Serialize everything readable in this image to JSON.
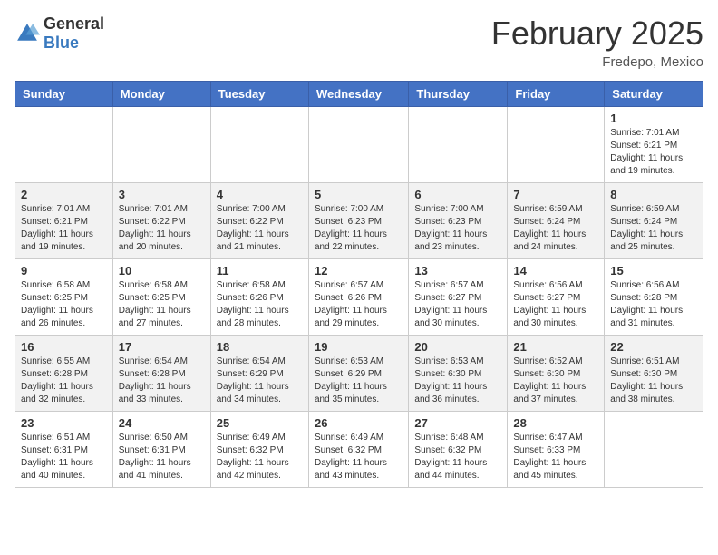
{
  "header": {
    "logo_general": "General",
    "logo_blue": "Blue",
    "month_title": "February 2025",
    "location": "Fredepo, Mexico"
  },
  "weekdays": [
    "Sunday",
    "Monday",
    "Tuesday",
    "Wednesday",
    "Thursday",
    "Friday",
    "Saturday"
  ],
  "weeks": [
    [
      {
        "day": "",
        "info": ""
      },
      {
        "day": "",
        "info": ""
      },
      {
        "day": "",
        "info": ""
      },
      {
        "day": "",
        "info": ""
      },
      {
        "day": "",
        "info": ""
      },
      {
        "day": "",
        "info": ""
      },
      {
        "day": "1",
        "info": "Sunrise: 7:01 AM\nSunset: 6:21 PM\nDaylight: 11 hours and 19 minutes."
      }
    ],
    [
      {
        "day": "2",
        "info": "Sunrise: 7:01 AM\nSunset: 6:21 PM\nDaylight: 11 hours and 19 minutes."
      },
      {
        "day": "3",
        "info": "Sunrise: 7:01 AM\nSunset: 6:22 PM\nDaylight: 11 hours and 20 minutes."
      },
      {
        "day": "4",
        "info": "Sunrise: 7:00 AM\nSunset: 6:22 PM\nDaylight: 11 hours and 21 minutes."
      },
      {
        "day": "5",
        "info": "Sunrise: 7:00 AM\nSunset: 6:23 PM\nDaylight: 11 hours and 22 minutes."
      },
      {
        "day": "6",
        "info": "Sunrise: 7:00 AM\nSunset: 6:23 PM\nDaylight: 11 hours and 23 minutes."
      },
      {
        "day": "7",
        "info": "Sunrise: 6:59 AM\nSunset: 6:24 PM\nDaylight: 11 hours and 24 minutes."
      },
      {
        "day": "8",
        "info": "Sunrise: 6:59 AM\nSunset: 6:24 PM\nDaylight: 11 hours and 25 minutes."
      }
    ],
    [
      {
        "day": "9",
        "info": "Sunrise: 6:58 AM\nSunset: 6:25 PM\nDaylight: 11 hours and 26 minutes."
      },
      {
        "day": "10",
        "info": "Sunrise: 6:58 AM\nSunset: 6:25 PM\nDaylight: 11 hours and 27 minutes."
      },
      {
        "day": "11",
        "info": "Sunrise: 6:58 AM\nSunset: 6:26 PM\nDaylight: 11 hours and 28 minutes."
      },
      {
        "day": "12",
        "info": "Sunrise: 6:57 AM\nSunset: 6:26 PM\nDaylight: 11 hours and 29 minutes."
      },
      {
        "day": "13",
        "info": "Sunrise: 6:57 AM\nSunset: 6:27 PM\nDaylight: 11 hours and 30 minutes."
      },
      {
        "day": "14",
        "info": "Sunrise: 6:56 AM\nSunset: 6:27 PM\nDaylight: 11 hours and 30 minutes."
      },
      {
        "day": "15",
        "info": "Sunrise: 6:56 AM\nSunset: 6:28 PM\nDaylight: 11 hours and 31 minutes."
      }
    ],
    [
      {
        "day": "16",
        "info": "Sunrise: 6:55 AM\nSunset: 6:28 PM\nDaylight: 11 hours and 32 minutes."
      },
      {
        "day": "17",
        "info": "Sunrise: 6:54 AM\nSunset: 6:28 PM\nDaylight: 11 hours and 33 minutes."
      },
      {
        "day": "18",
        "info": "Sunrise: 6:54 AM\nSunset: 6:29 PM\nDaylight: 11 hours and 34 minutes."
      },
      {
        "day": "19",
        "info": "Sunrise: 6:53 AM\nSunset: 6:29 PM\nDaylight: 11 hours and 35 minutes."
      },
      {
        "day": "20",
        "info": "Sunrise: 6:53 AM\nSunset: 6:30 PM\nDaylight: 11 hours and 36 minutes."
      },
      {
        "day": "21",
        "info": "Sunrise: 6:52 AM\nSunset: 6:30 PM\nDaylight: 11 hours and 37 minutes."
      },
      {
        "day": "22",
        "info": "Sunrise: 6:51 AM\nSunset: 6:30 PM\nDaylight: 11 hours and 38 minutes."
      }
    ],
    [
      {
        "day": "23",
        "info": "Sunrise: 6:51 AM\nSunset: 6:31 PM\nDaylight: 11 hours and 40 minutes."
      },
      {
        "day": "24",
        "info": "Sunrise: 6:50 AM\nSunset: 6:31 PM\nDaylight: 11 hours and 41 minutes."
      },
      {
        "day": "25",
        "info": "Sunrise: 6:49 AM\nSunset: 6:32 PM\nDaylight: 11 hours and 42 minutes."
      },
      {
        "day": "26",
        "info": "Sunrise: 6:49 AM\nSunset: 6:32 PM\nDaylight: 11 hours and 43 minutes."
      },
      {
        "day": "27",
        "info": "Sunrise: 6:48 AM\nSunset: 6:32 PM\nDaylight: 11 hours and 44 minutes."
      },
      {
        "day": "28",
        "info": "Sunrise: 6:47 AM\nSunset: 6:33 PM\nDaylight: 11 hours and 45 minutes."
      },
      {
        "day": "",
        "info": ""
      }
    ]
  ]
}
